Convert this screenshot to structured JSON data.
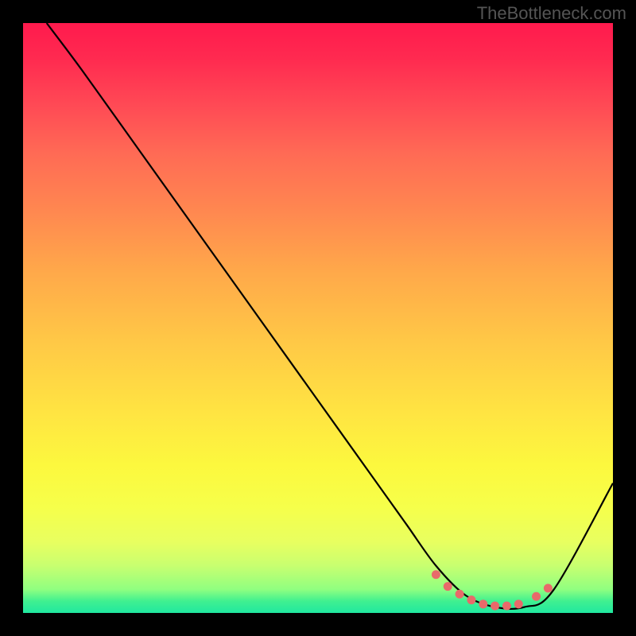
{
  "watermark": "TheBottleneck.com",
  "chart_data": {
    "type": "line",
    "title": "",
    "xlabel": "",
    "ylabel": "",
    "xlim": [
      0,
      100
    ],
    "ylim": [
      0,
      100
    ],
    "series": [
      {
        "name": "bottleneck-curve",
        "x": [
          4,
          10,
          20,
          30,
          40,
          50,
          60,
          65,
          70,
          75,
          80,
          85,
          90,
          100
        ],
        "y": [
          100,
          92,
          78,
          64,
          50,
          36,
          22,
          15,
          8,
          3,
          1,
          1,
          4,
          22
        ]
      }
    ],
    "highlight_points": {
      "name": "optimal-range",
      "x": [
        70,
        72,
        74,
        76,
        78,
        80,
        82,
        84,
        87,
        89
      ],
      "y": [
        6.5,
        4.5,
        3.2,
        2.2,
        1.5,
        1.2,
        1.2,
        1.5,
        2.8,
        4.2
      ]
    },
    "gradient_stops": [
      {
        "pos": 0,
        "color": "#ff1a4d"
      },
      {
        "pos": 50,
        "color": "#ffc040"
      },
      {
        "pos": 85,
        "color": "#f8ff50"
      },
      {
        "pos": 100,
        "color": "#20e8a0"
      }
    ]
  }
}
